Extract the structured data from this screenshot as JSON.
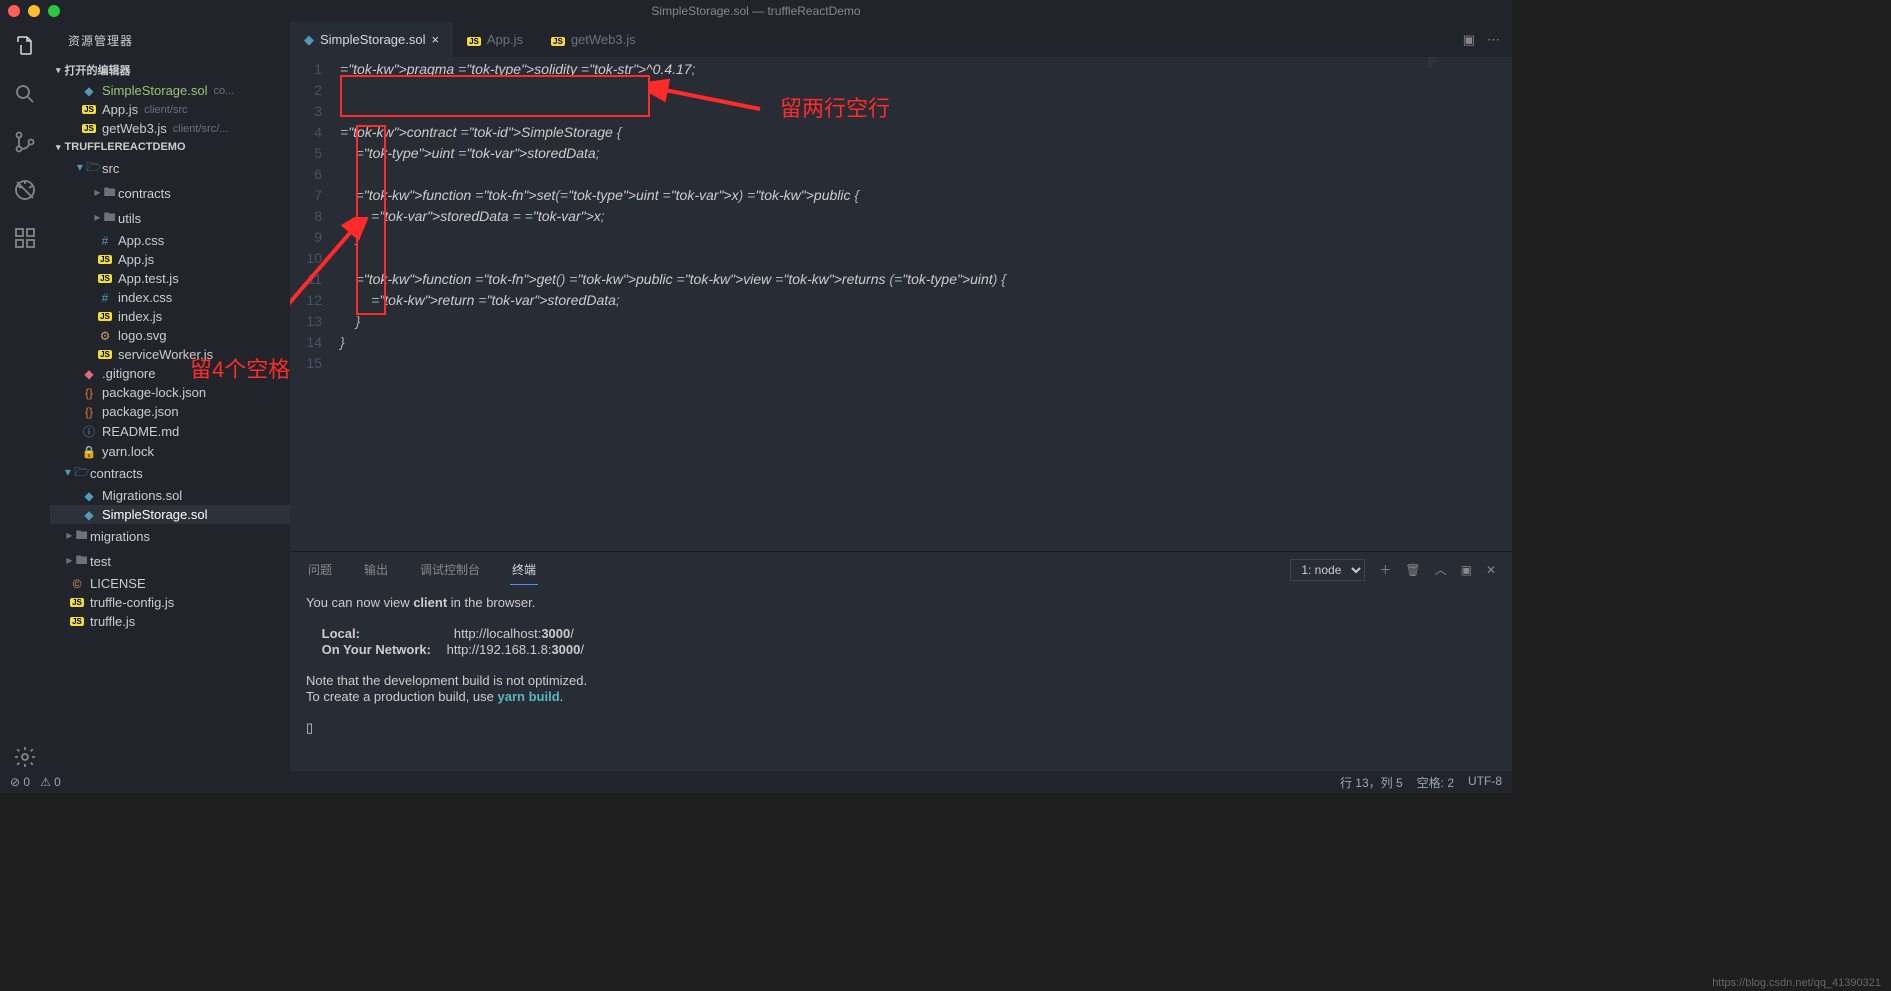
{
  "title": "SimpleStorage.sol — truffleReactDemo",
  "sidebar": {
    "title": "资源管理器",
    "open_editors_label": "打开的编辑器",
    "open_editors": [
      {
        "name": "SimpleStorage.sol",
        "meta": "co...",
        "icon": "sol",
        "active": true
      },
      {
        "name": "App.js",
        "meta": "client/src",
        "icon": "js"
      },
      {
        "name": "getWeb3.js",
        "meta": "client/src/...",
        "icon": "js"
      }
    ],
    "project_name": "TRUFFLEREACTDEMO",
    "tree": [
      {
        "name": "src",
        "icon": "folder-open",
        "depth": 1
      },
      {
        "name": "contracts",
        "icon": "folder",
        "depth": 2
      },
      {
        "name": "utils",
        "icon": "folder",
        "depth": 2
      },
      {
        "name": "App.css",
        "icon": "css",
        "depth": 2
      },
      {
        "name": "App.js",
        "icon": "js",
        "depth": 2
      },
      {
        "name": "App.test.js",
        "icon": "js",
        "depth": 2
      },
      {
        "name": "index.css",
        "icon": "css",
        "depth": 2
      },
      {
        "name": "index.js",
        "icon": "js",
        "depth": 2
      },
      {
        "name": "logo.svg",
        "icon": "svg",
        "depth": 2
      },
      {
        "name": "serviceWorker.js",
        "icon": "js",
        "depth": 2
      },
      {
        "name": ".gitignore",
        "icon": "git",
        "depth": 1
      },
      {
        "name": "package-lock.json",
        "icon": "json",
        "depth": 1
      },
      {
        "name": "package.json",
        "icon": "json",
        "depth": 1
      },
      {
        "name": "README.md",
        "icon": "info",
        "depth": 1
      },
      {
        "name": "yarn.lock",
        "icon": "yarn",
        "depth": 1
      },
      {
        "name": "contracts",
        "icon": "folder-open",
        "depth": 0
      },
      {
        "name": "Migrations.sol",
        "icon": "sol",
        "depth": 1
      },
      {
        "name": "SimpleStorage.sol",
        "icon": "sol",
        "depth": 1,
        "active": true
      },
      {
        "name": "migrations",
        "icon": "folder",
        "depth": 0
      },
      {
        "name": "test",
        "icon": "folder",
        "depth": 0
      },
      {
        "name": "LICENSE",
        "icon": "license",
        "depth": 0
      },
      {
        "name": "truffle-config.js",
        "icon": "js",
        "depth": 0
      },
      {
        "name": "truffle.js",
        "icon": "js",
        "depth": 0
      }
    ]
  },
  "tabs": [
    {
      "name": "SimpleStorage.sol",
      "icon": "sol",
      "active": true,
      "close": "×"
    },
    {
      "name": "App.js",
      "icon": "js"
    },
    {
      "name": "getWeb3.js",
      "icon": "js"
    }
  ],
  "code_lines": [
    "pragma solidity ^0.4.17;",
    "",
    "",
    "contract SimpleStorage {",
    "    uint storedData;",
    "",
    "    function set(uint x) public {",
    "        storedData = x;",
    "    }",
    "",
    "    function get() public view returns (uint) {",
    "        return storedData;",
    "    }",
    "}",
    ""
  ],
  "annotations": {
    "text1": "留两行空行",
    "text2": "留4个空格"
  },
  "panel": {
    "tabs": [
      "问题",
      "输出",
      "调试控制台",
      "终端"
    ],
    "active_tab": "终端",
    "terminal_selector": "1: node",
    "output_line1": "You can now view ",
    "output_bold1": "client",
    "output_line1b": " in the browser.",
    "output_local_label": "Local:",
    "output_local_url": "http://localhost:",
    "output_local_port": "3000",
    "output_local_slash": "/",
    "output_net_label": "On Your Network:",
    "output_net_url": "http://192.168.1.8:",
    "output_net_port": "3000",
    "output_net_slash": "/",
    "output_note1": "Note that the development build is not optimized.",
    "output_note2a": "To create a production build, use ",
    "output_note2b": "yarn build",
    "output_note2c": ".",
    "cursor": "▯"
  },
  "statusbar": {
    "errors": "⊘ 0",
    "warnings": "⚠ 0",
    "line_col": "行 13，列 5",
    "spaces": "空格: 2",
    "encoding": "UTF-8"
  },
  "watermark": "https://blog.csdn.net/qq_41390321"
}
